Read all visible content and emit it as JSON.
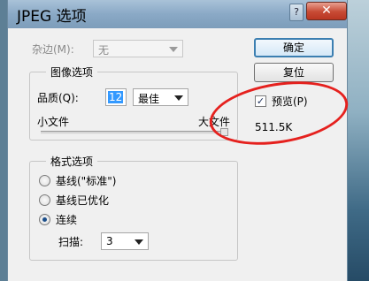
{
  "dialog": {
    "title": "JPEG 选项",
    "help_icon": "?",
    "close_icon": "✕"
  },
  "matte": {
    "label": "杂边(M):",
    "value": "无"
  },
  "image_options": {
    "legend": "图像选项",
    "quality_label": "品质(Q):",
    "quality_value": "12",
    "quality_preset": "最佳",
    "slider_min_label": "小文件",
    "slider_max_label": "大文件",
    "slider_value_fraction": 1.0
  },
  "format_options": {
    "legend": "格式选项",
    "radios": [
      {
        "label": "基线(\"标准\")",
        "checked": false
      },
      {
        "label": "基线已优化",
        "checked": false
      },
      {
        "label": "连续",
        "checked": true
      }
    ],
    "scans_label": "扫描:",
    "scans_value": "3"
  },
  "buttons": {
    "ok": "确定",
    "reset": "复位"
  },
  "preview": {
    "label": "预览(P)",
    "checked": true,
    "size": "511.5K"
  },
  "annotation": {
    "color": "#e5211e"
  }
}
